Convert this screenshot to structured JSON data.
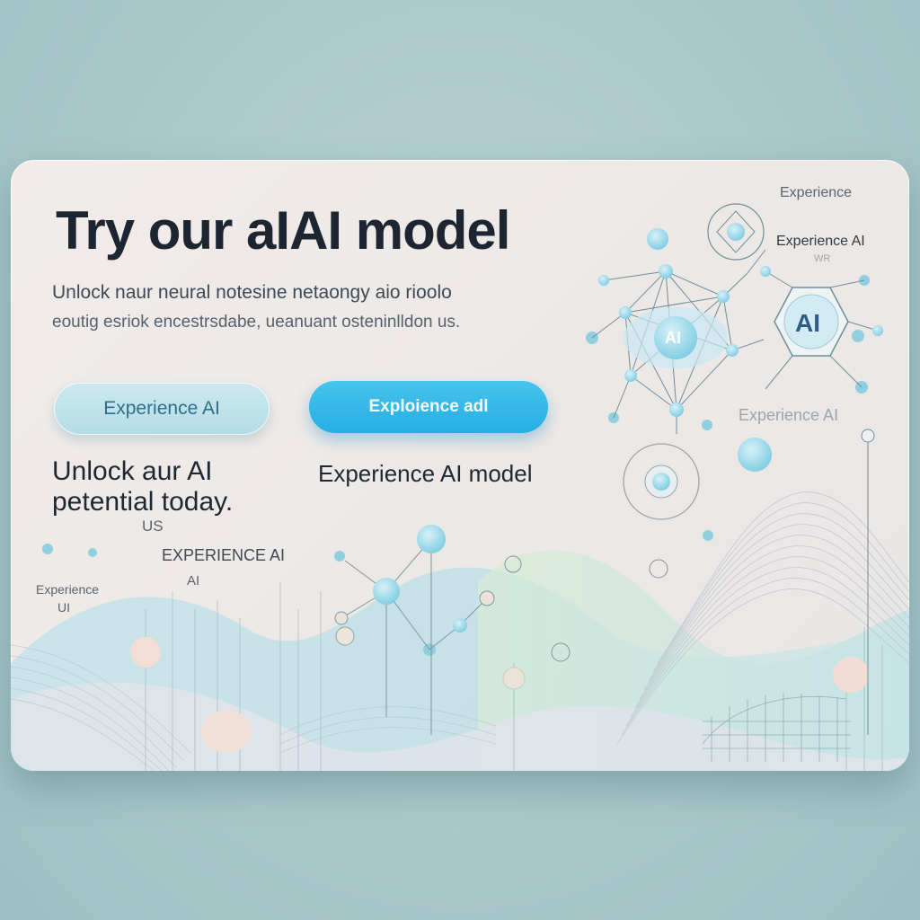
{
  "hero": {
    "title": "Try our aIAI model",
    "subtitle_line1": "Unlock naur neural notesine netaongy aio rioolo",
    "subtitle_line2": "eoutig esriok encestrsdabe, ueanuant osteninlldon us."
  },
  "buttons": {
    "secondary_label": "Experience AI",
    "primary_label": "Exploience adl"
  },
  "body": {
    "left_headline": "Unlock aur AI petential today.",
    "right_headline": "Experience AI model",
    "us_label": "US",
    "experience_caps": "EXPERIENCE AI",
    "ai_small": "AI",
    "experience_small": "Experience",
    "ui_small": "UI"
  },
  "network": {
    "top_right_label_1": "Experience",
    "top_right_label_2": "Experience AI",
    "top_right_label_3": "WR",
    "node_label_center": "AI",
    "node_label_hex": "AI",
    "faded_label": "Experience AI"
  },
  "colors": {
    "accent": "#26aee4",
    "node": "#8fd3e6",
    "wave_teal": "#bfe2e4",
    "wave_green": "#cfe6d9",
    "peach": "#f2ddd6"
  }
}
